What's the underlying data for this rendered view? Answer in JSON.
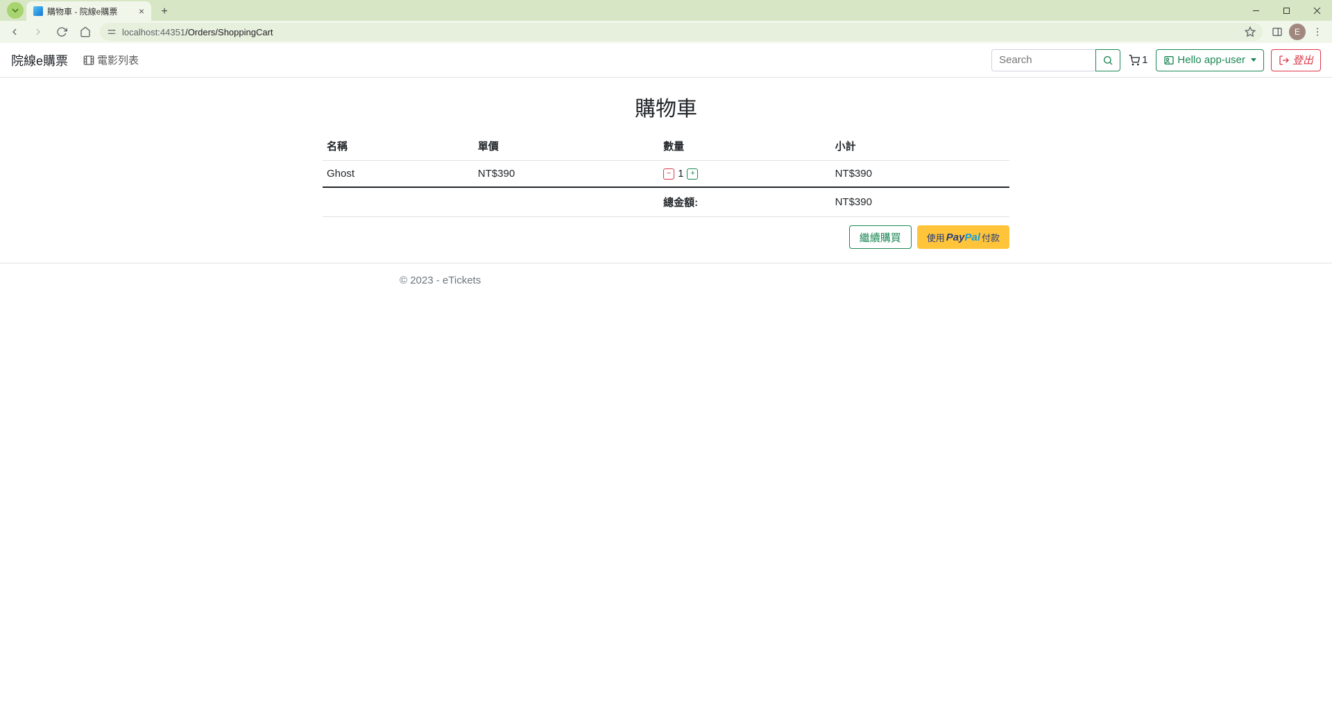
{
  "browser": {
    "tab_title": "購物車 - 院線e購票",
    "url_host": "localhost:44351",
    "url_path": "/Orders/ShoppingCart",
    "avatar_initial": "E"
  },
  "nav": {
    "brand": "院線e購票",
    "movies_link": "電影列表",
    "search_placeholder": "Search",
    "cart_count": "1",
    "hello_label": "Hello app-user",
    "logout_label": "登出"
  },
  "page": {
    "title": "購物車",
    "columns": {
      "name": "名稱",
      "price": "單價",
      "qty": "數量",
      "subtotal": "小計"
    },
    "items": [
      {
        "name": "Ghost",
        "price": "NT$390",
        "qty": "1",
        "subtotal": "NT$390"
      }
    ],
    "total_label": "總金額:",
    "total_value": "NT$390",
    "continue_label": "繼續購買",
    "paypal_prefix": "使用",
    "paypal_suffix": "付款"
  },
  "footer": {
    "text": "© 2023 - eTickets"
  }
}
